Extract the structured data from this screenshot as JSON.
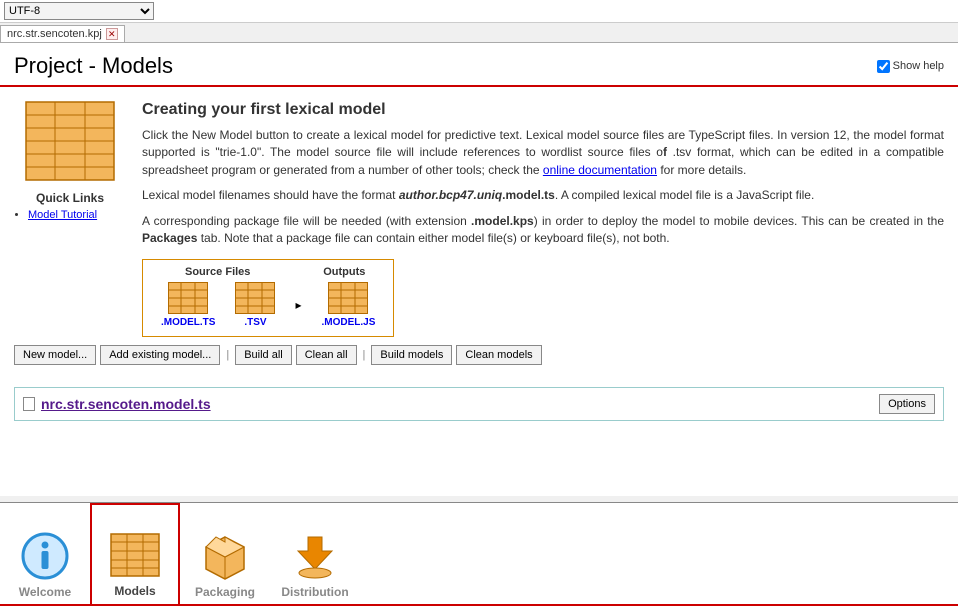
{
  "top": {
    "encoding": "UTF-8",
    "tab_label": "nrc.str.sencoten.kpj"
  },
  "header": {
    "title": "Project - Models",
    "show_help_label": "Show help"
  },
  "left": {
    "quick_links_title": "Quick Links",
    "tutorial_link": "Model Tutorial"
  },
  "intro": {
    "heading": "Creating your first lexical model",
    "p1a": "Click the New Model button to create a lexical model for predictive text. Lexical model source files are TypeScript files. In version 12, the model format supported is \"trie-1.0\". The model source file will include references to wordlist source files o",
    "p1b": "f",
    "p1c": " .tsv format, which can be edited in a compatible spreadsheet program or generated from a number of other tools; check the ",
    "p1_link": "online documentation",
    "p1d": " for more details.",
    "p2a": "Lexical model filenames should have the format ",
    "p2b": "author.bcp47.uniq",
    "p2c": ".model.ts",
    "p2d": ". A compiled lexical model file is a JavaScript file.",
    "p3a": "A corresponding package file will be needed (with extension ",
    "p3b": ".model.kps",
    "p3c": ") in order to deploy the model to mobile devices. This can be created in the ",
    "p3d": "Packages",
    "p3e": " tab. Note that a package file can contain either model file(s) or keyboard file(s), not both."
  },
  "diagram": {
    "source_header": "Source Files",
    "output_header": "Outputs",
    "model_ts": ".MODEL.TS",
    "tsv": ".TSV",
    "model_js": ".MODEL.JS"
  },
  "buttons": {
    "new_model": "New model...",
    "add_existing": "Add existing model...",
    "build_all": "Build all",
    "clean_all": "Clean all",
    "build_models": "Build models",
    "clean_models": "Clean models",
    "options": "Options"
  },
  "model_row": {
    "filename": "nrc.str.sencoten.model.ts"
  },
  "tabs": {
    "welcome": "Welcome",
    "models": "Models",
    "packaging": "Packaging",
    "distribution": "Distribution"
  }
}
